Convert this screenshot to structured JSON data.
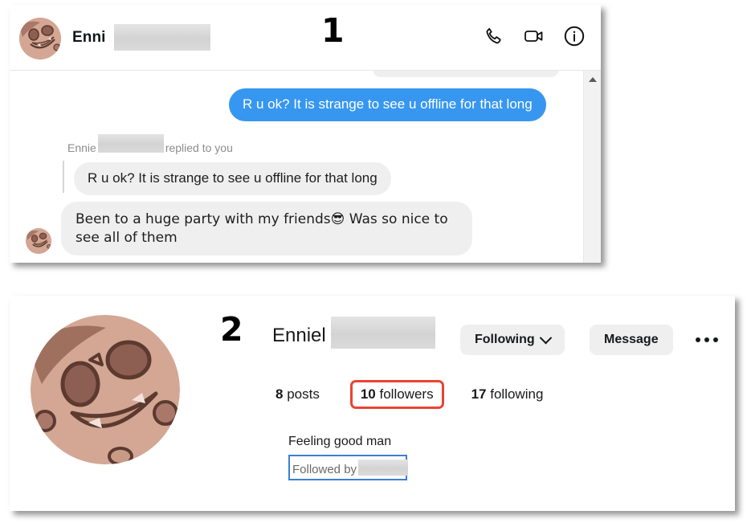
{
  "annotations": {
    "step_one": "1",
    "step_two": "2"
  },
  "chat": {
    "header": {
      "contact_name": "Enni",
      "avatar_icon": "cartoon-face-avatar",
      "actions": [
        {
          "name": "audio-call",
          "icon": "phone-icon"
        },
        {
          "name": "video-call",
          "icon": "video-camera-icon"
        },
        {
          "name": "conversation-info",
          "icon": "info-circle-icon"
        }
      ]
    },
    "messages": [
      {
        "id": "outgoing-1",
        "direction": "outgoing",
        "text": "R u ok? It is strange to see u offline for that long"
      },
      {
        "id": "reply-meta",
        "direction": "meta",
        "author": "Ennie",
        "text": "replied to you"
      },
      {
        "id": "quoted-1",
        "direction": "incoming",
        "text": "R u ok? It is strange to see u offline for that long"
      },
      {
        "id": "incoming-1",
        "direction": "incoming",
        "text": "Been to a huge party with my friends😎 Was so nice to see all of them"
      }
    ],
    "scrollbar": {
      "up_arrow_icon": "triangle-up-icon"
    }
  },
  "profile": {
    "avatar_icon": "cartoon-face-avatar",
    "username": "Enniel",
    "buttons": {
      "following_label": "Following",
      "following_chevron_icon": "chevron-down-icon",
      "message_label": "Message",
      "more_options_icon": "ellipsis-icon"
    },
    "stats": {
      "posts_count": "8",
      "posts_label": "posts",
      "followers_count": "10",
      "followers_label": "followers",
      "following_count": "17",
      "following_label": "following"
    },
    "bio": "Feeling good man",
    "followed_by_label": "Followed by"
  },
  "colors": {
    "outgoing_bubble": "#3797f0",
    "incoming_bubble": "#efefef",
    "highlight_red": "#ea4335",
    "highlight_blue": "#3e7fd0",
    "redaction_gray": "#d9d9d9"
  }
}
